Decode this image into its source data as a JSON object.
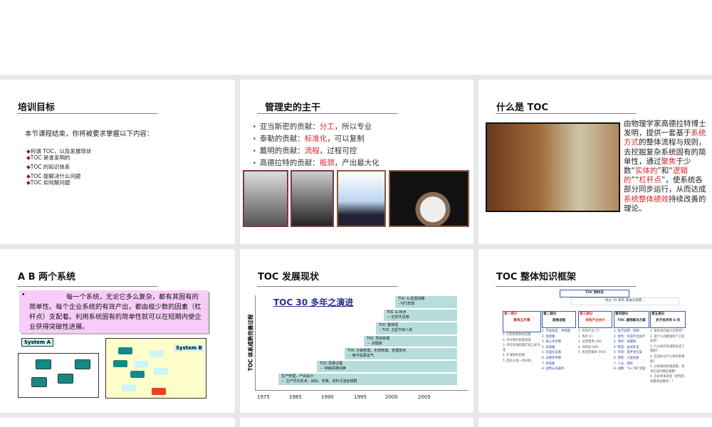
{
  "slides": [
    {
      "title": "培训目标",
      "intro": "本节课程结束，你将被要求掌握以下内容：",
      "bullets": [
        "何谓 TOC，以及发展现状",
        "TOC 是谁发明的",
        "TOC 的知识体系",
        "TOC 能解决什么问题",
        "TOC 如何解问题"
      ]
    },
    {
      "title": "管理史的主干",
      "bullets": [
        {
          "pre": "亚当斯密的贡献：",
          "hl": "分工",
          "post": "，所以专业"
        },
        {
          "pre": "泰勒的贡献：",
          "hl": "标准化",
          "post": "，可以复制"
        },
        {
          "pre": "戴明的贡献：",
          "hl": "流程",
          "post": "，过程可控"
        },
        {
          "pre": "高德拉特的贡献：",
          "hl": "瓶颈",
          "post": "，产出最大化"
        }
      ]
    },
    {
      "title": "什么是 TOC",
      "text": [
        "由物理学家高德拉特博士发明，提供一套基于",
        "系统方式",
        "的整体流程与规则，去挖掘复杂系统固有的简单性，通过",
        "聚焦",
        "于少数“",
        "实体的",
        "”和“",
        "逻辑的",
        "”“",
        "杠杆点",
        "”，使系统各部分同步运行，从而达成",
        "系统整体绩效",
        "持续改善的理论。"
      ]
    },
    {
      "title": "A B 两个系统",
      "bullet": "每一个系统，无论它多么复杂，都有其固有的简单性。每个企业系统的有效产出，都由极少数的因素（杠杆点）支配着。利用系统固有的简单性就可以在短期内使企业获得突破性进展。",
      "system_a": "System A",
      "system_b": "System B"
    },
    {
      "title": "TOC 发展现状",
      "chart_title_num": "TOC 30",
      "chart_title_rest": " 多年之演进",
      "ylabel": "TOC 体系成熟完善过程",
      "years": [
        "1975",
        "1985",
        "1990",
        "1995",
        "2000",
        "2005"
      ],
      "steps": [
        {
          "l1": "生产管理，产出会计",
          "l2": "－ 生产优化技术，目标，竞赛，资料泛滥症候群"
        },
        {
          "l1": "TOC 思维过程",
          "l2": "－ 钟納思維训練"
        },
        {
          "l1": "TOC 分销管理，市场管理，管理技术",
          "l2": "－ 绝不是靠运气"
        },
        {
          "l1": "TOC 项目管理",
          "l2": "－ 关键链"
        },
        {
          "l1": "TOC 整体观",
          "l2": "－TOC 卫星节目八讲"
        },
        {
          "l1": "TOC & 技术",
          "l2": "－ 仍然不足够"
        },
        {
          "l1": "TOC & 经营战略",
          "l2": "- 可行愿景"
        }
      ]
    },
    {
      "title": "TOC 整体知识框架",
      "root": "TOC 制约法",
      "sub": "经过 30 年的  发展与演变…",
      "cols": [
        {
          "part": "第一部分",
          "name": "聚焦五步骤",
          "items": [
            "1. 识别系统制约因素",
            "2. 挖尽制约因素资源",
            "3. 所有其他因素迁就上述决定",
            "4. 扩展制约因素",
            "5. 回头从第一步开始。"
          ]
        },
        {
          "part": "第二部分",
          "name": "思维流程",
          "items": [
            "1. 不良效应：冲突图",
            "2. 现状图",
            "3. 核心冲突图",
            "4. 未来图",
            "5. 负面分支图",
            "6. 必要条件图",
            "7. 转变图",
            "8. 谈判与沟通术"
          ]
        },
        {
          "part": "第三部分",
          "name": "有效产出会计",
          "items": [
            "1. 有效产出 (T)",
            "2. 库存 (I)",
            "3. 运营费用 (OE)",
            "4. 净利润 (NP)",
            "5. 投资回报率 (ROI)"
          ]
        },
        {
          "part": "第四部分",
          "name": "TOC 通用解决方案",
          "items": [
            "1. 生产运营：DBR",
            "2. 财务：有效产出会计",
            "3. 项目：关键链",
            "4. 物流：拉式补货",
            "5. 市场：黑手党方案",
            "6. 销售：六层抗拒",
            "7. 人员：授权",
            "8. 战略：“S+T树”流程"
          ]
        },
        {
          "part": "第五部分",
          "name": "关于技术的 6 问",
          "items": [
            "1. 新技术的威力在哪里？",
            "2. 是什么因素限制了它的发挥？",
            "3. 什么样的老规矩造成了限制？",
            "4. 应该树立什么样的新规则？",
            "5. 从新规则的角度看，技术应该作哪些调整？",
            "6. 怎样带来改变（新型的双赢商业模式）?"
          ]
        }
      ]
    }
  ],
  "colors": {
    "highlight": "#d9262b",
    "bullet": "#8b1a1a",
    "step": "#b7dcdc",
    "pink": "#f8ccf8",
    "teal": "#138a86",
    "yellow": "#ffffcc"
  }
}
